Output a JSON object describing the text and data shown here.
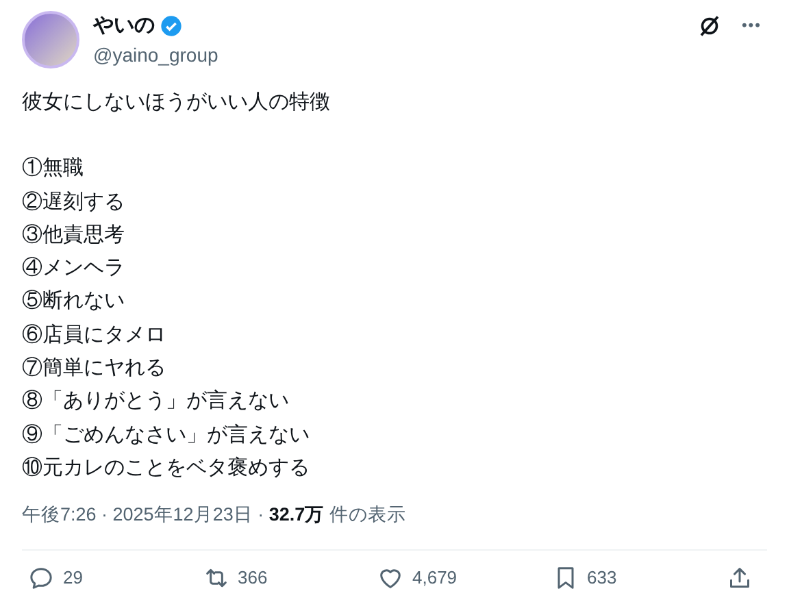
{
  "author": {
    "name": "やいの",
    "verified": true,
    "handle": "@yaino_group"
  },
  "header_icons": [
    "•••"
  ],
  "post": {
    "title": "彼女にしないほうがいい人の特徴",
    "lines": [
      "①無職",
      "②遅刻する",
      "③他責思考",
      "④メンヘラ",
      "⑤断れない",
      "⑥店員にタメロ",
      "⑦簡単にヤれる",
      "⑧「ありがとう」が言えない",
      "⑨「ごめんなさい」が言えない",
      "⑩元カレのことをベタ褒めする"
    ]
  },
  "meta": "午後7:26 · 2025年12月23日 · **32.7万** 件の表示",
  "actions": [
    {
      "kind": "reply",
      "count": "29"
    },
    {
      "kind": "repost",
      "count": "366"
    },
    {
      "kind": "like",
      "count": "4,679"
    },
    {
      "kind": "bookmark",
      "count": "633"
    },
    {
      "kind": "share"
    }
  ]
}
